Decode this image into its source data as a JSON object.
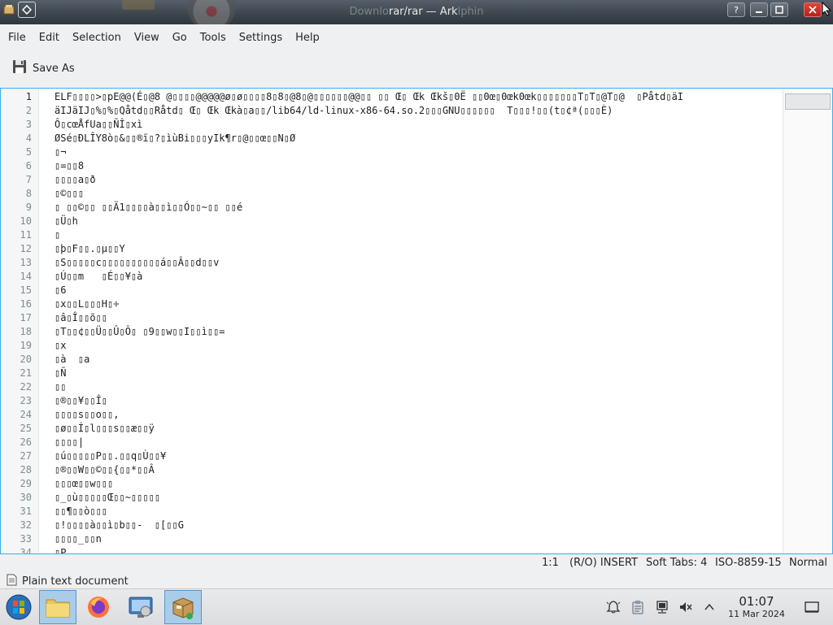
{
  "window": {
    "title_ghost": "Downlo",
    "title": "rar/rar — Ark",
    "title_ghost2": "lphin"
  },
  "menu": [
    "File",
    "Edit",
    "Selection",
    "View",
    "Go",
    "Tools",
    "Settings",
    "Help"
  ],
  "toolbar": {
    "save_as_label": "Save As"
  },
  "editor": {
    "line_numbers": [
      "1",
      "2",
      "3",
      "4",
      "5",
      "6",
      "7",
      "8",
      "9",
      "10",
      "11",
      "12",
      "13",
      "14",
      "15",
      "16",
      "17",
      "18",
      "19",
      "20",
      "21",
      "22",
      "23",
      "24",
      "25",
      "26",
      "27",
      "28",
      "29",
      "30",
      "31",
      "32",
      "33",
      "34"
    ],
    "lines": [
      "ELF▯▯▯▯>▯pE@@(É▯@8 @▯▯▯▯@@@@@ø▯ø▯▯▯▯8▯8▯@8▯@▯▯▯▯▯▯@@▯▯ ▯▯ Œ▯ Œk Œkš▯0Ë ▯▯0œ▯0œk0œk▯▯▯▯▯▯▯T▯T▯@T▯@  ▯Påtd▯äI",
      "äIJäIJ▯%▯%▯Qåtd▯▯Råtd▯ Œ▯ Œk Œkà▯a▯▯/lib64/ld-linux-x86-64.so.2▯▯▯GNU▯▯▯▯▯▯  T▯▯▯!▯▯(t▯¢ª(▯▯▯È)",
      "Ô▯cœÅfUa▯▯ÑÎ▯xì",
      "ØSé▯ÐLÎY8ò▯&▯▯®ï▯?▯ìùBi▯▯▯yIk¶r▯@▯▯œ▯▯N▯Ø",
      "▯¬",
      "▯=▯▯8",
      "▯▯▯▯a▯ð",
      "▯©▯▯▯",
      "▯ ▯▯©▯▯ ▯▯Ä1▯▯▯▯à▯▯ì▯▯Ó▯▯~▯▯ ▯▯é",
      "▯Ü▯h",
      "▯",
      "▯þ▯F▯▯.▯µ▯▯Y",
      "▯S▯▯▯▯▯c▯▯▯▯▯▯▯▯▯▯á▯▯Â▯▯d▯▯v",
      "▯Ú▯▯m   ▯É▯▯¥▯à",
      "▯6",
      "▯x▯▯L▯▯▯H▯÷",
      "▯â▯Î▯▯õ▯▯",
      "▯T▯▯¢▯▯Ü▯▯Û▯Ô▯ ▯9▯▯w▯▯I▯▯ì▯▯=",
      "▯x",
      "▯à  ▯a",
      "▯Ñ",
      "▯▯",
      "▯®▯▯¥▯▯Î▯",
      "▯▯▯▯s▯▯o▯▯,",
      "▯ø▯▯Í▯l▯▯▯s▯▯æ▯▯ÿ",
      "▯▯▯▯|",
      "▯ú▯▯▯▯▯P▯▯.▯▯q▯Ù▯▯¥",
      "▯®▯▯W▯▯©▯▯{▯▯*▯▯Â",
      "▯▯▯œ▯▯w▯▯▯",
      "▯_▯ù▯▯▯▯▯Œ▯▯~▯▯▯▯▯",
      "▯▯¶▯▯ò▯▯▯",
      "▯!▯▯▯▯à▯▯ì▯b▯▯-  ▯[▯▯G",
      "▯▯▯▯_▯▯n",
      "▯P"
    ]
  },
  "status": {
    "cursor": "1:1",
    "mode": "(R/O) INSERT",
    "tabs": "Soft Tabs: 4",
    "encoding": "ISO-8859-15",
    "input_mode": "Normal"
  },
  "doc_type": "Plain text document",
  "taskbar": {
    "time": "01:07",
    "date": "11 Mar 2024"
  },
  "colors": {
    "accent": "#3daee9",
    "task_active": "#a9cde8"
  },
  "icons": [
    "window-menu-icon",
    "pin-icon",
    "help-icon",
    "minimize-icon",
    "maximize-icon",
    "close-icon",
    "save-as-icon",
    "document-icon",
    "start-icon",
    "file-manager-icon",
    "firefox-icon",
    "system-settings-icon",
    "ark-icon",
    "notifications-icon",
    "clipboard-icon",
    "network-icon",
    "volume-muted-icon",
    "expand-tray-icon",
    "show-desktop-icon"
  ]
}
